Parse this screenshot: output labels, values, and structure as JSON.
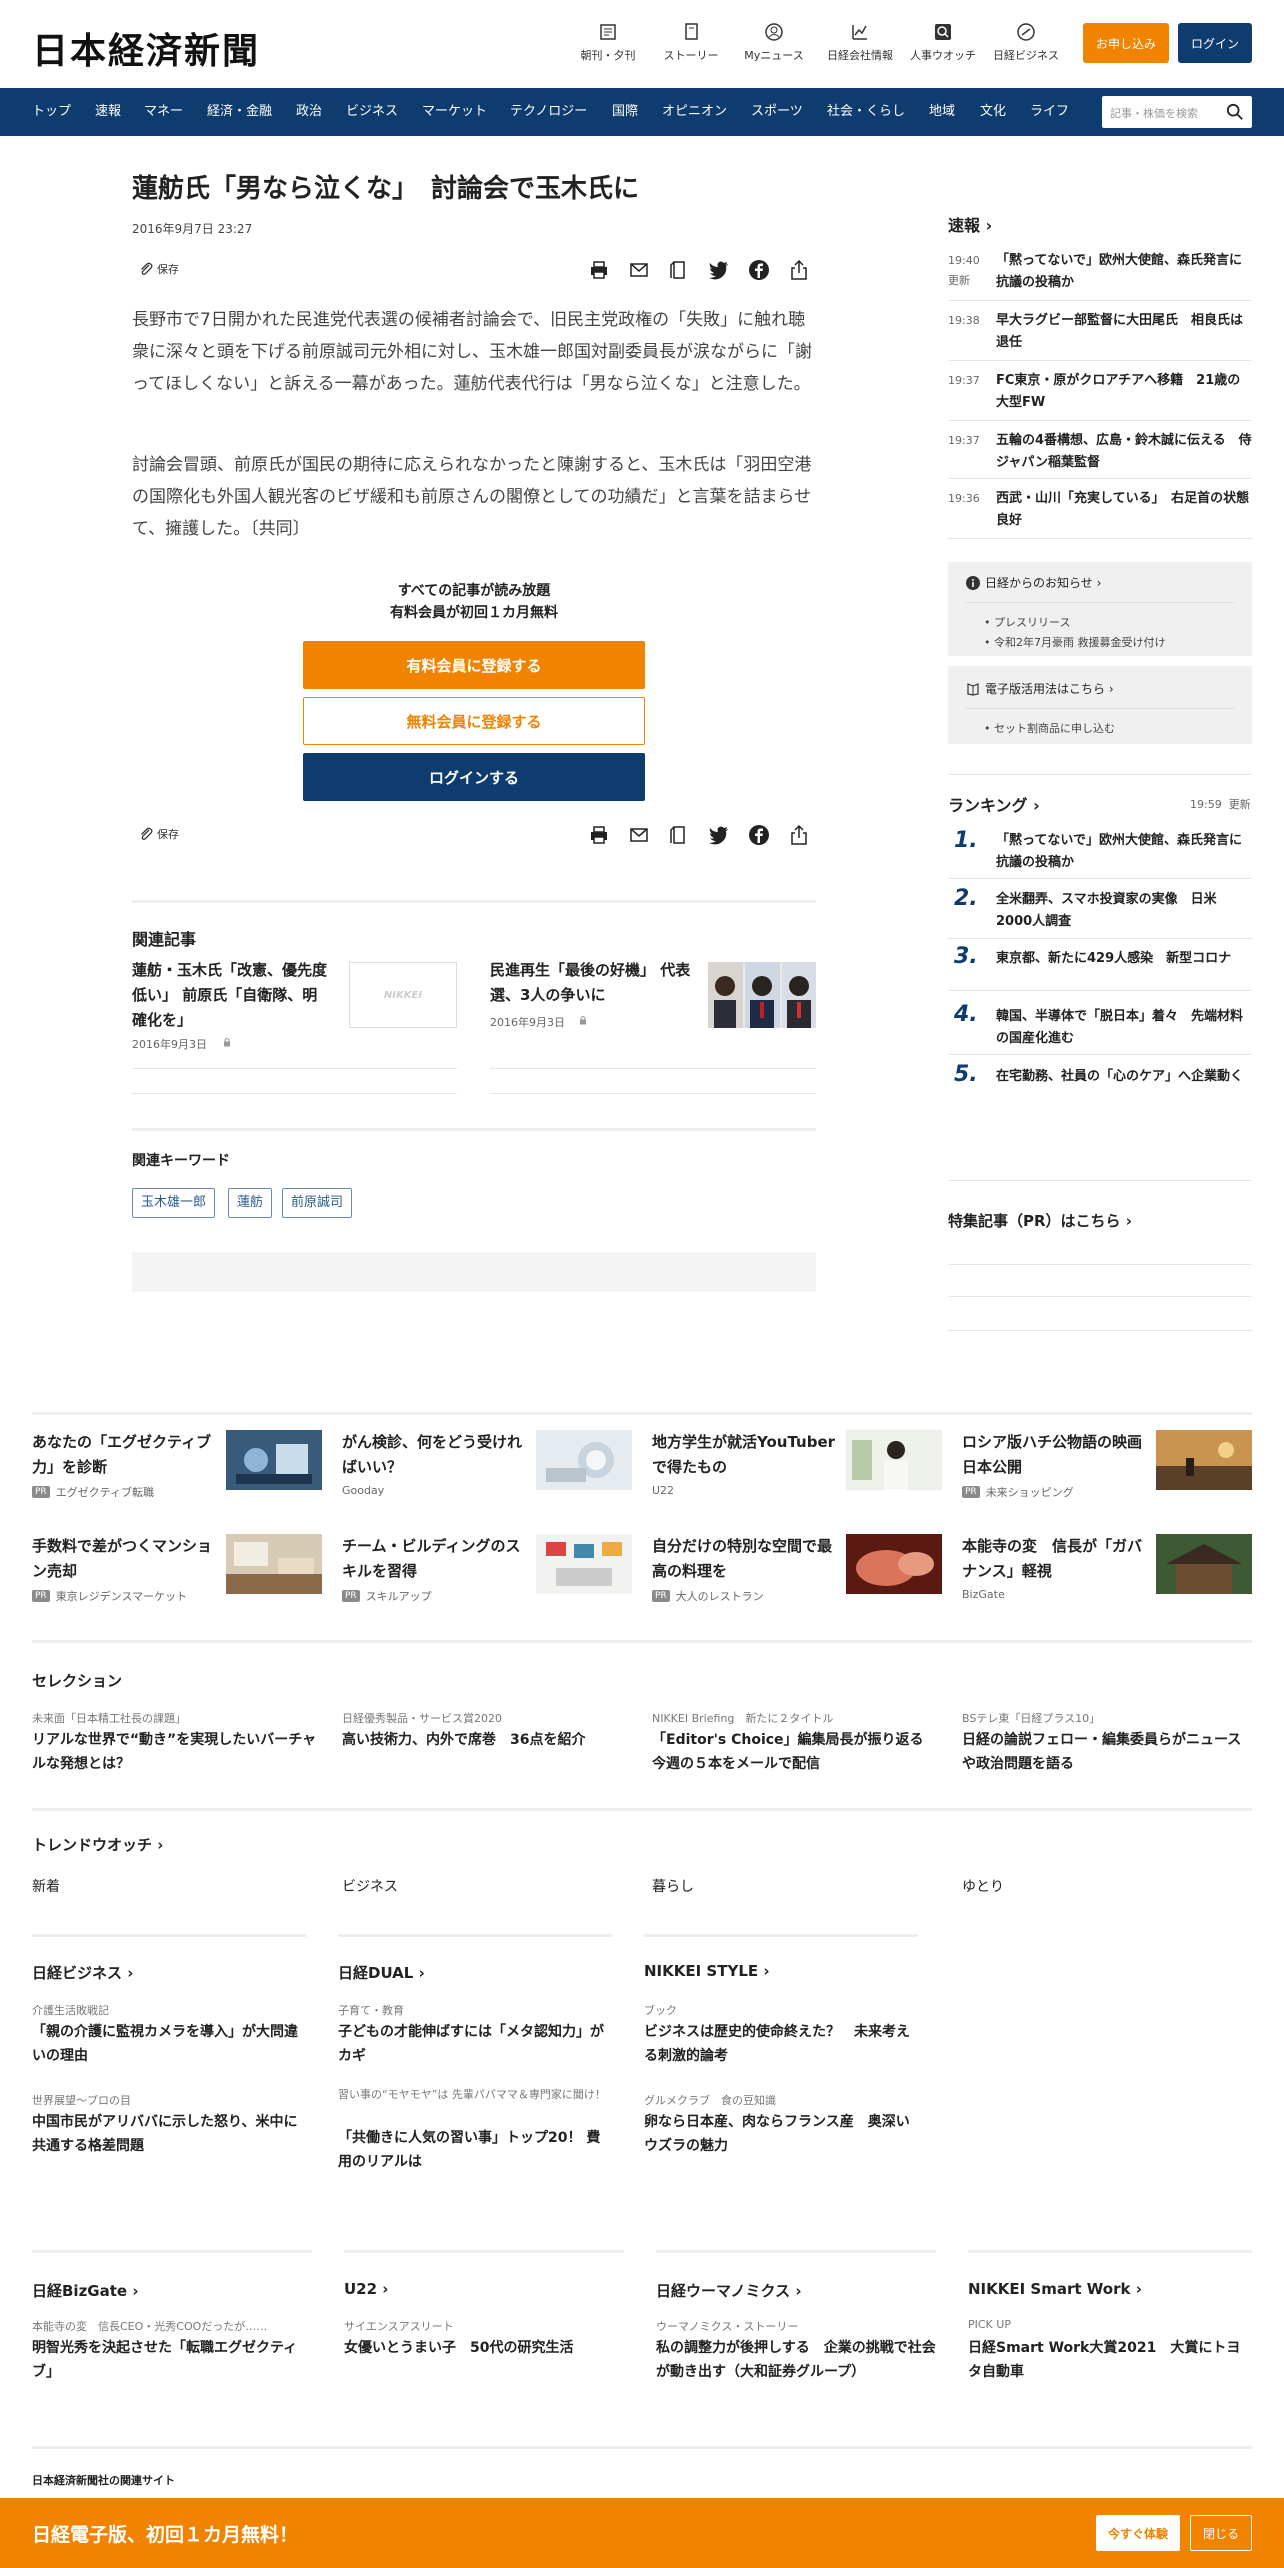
{
  "header": {
    "logo": "日本経済新聞",
    "nav": [
      {
        "label": "朝刊・夕刊",
        "icon": "newspaper-icon"
      },
      {
        "label": "ストーリー",
        "icon": "story-icon"
      },
      {
        "label": "Myニュース",
        "icon": "user-icon"
      },
      {
        "label": "日経会社情報",
        "icon": "chart-icon"
      },
      {
        "label": "人事ウオッチ",
        "icon": "search-person-icon"
      },
      {
        "label": "日経ビジネス",
        "icon": "business-icon"
      }
    ],
    "apply": "お申し込み",
    "login": "ログイン"
  },
  "navbar": {
    "items": [
      "トップ",
      "速報",
      "マネー",
      "経済・金融",
      "政治",
      "ビジネス",
      "マーケット",
      "テクノロジー",
      "国際",
      "オピニオン",
      "スポーツ",
      "社会・くらし",
      "地域",
      "文化",
      "ライフ"
    ],
    "search_placeholder": "記事・株価を検索"
  },
  "article": {
    "title": "蓮舫氏「男なら泣くな」　討論会で玉木氏に",
    "date": "2016年9月7日 23:27",
    "save": "保存",
    "paragraphs": [
      "長野市で7日開かれた民進党代表選の候補者討論会で、旧民主党政権の「失敗」に触れ聴衆に深々と頭を下げる前原誠司元外相に対し、玉木雄一郎国対副委員長が涙ながらに「謝ってほしくない」と訴える一幕があった。蓮舫代表代行は「男なら泣くな」と注意した。",
      "討論会冒頭、前原氏が国民の期待に応えられなかったと陳謝すると、玉木氏は「羽田空港の国際化も外国人観光客のビザ緩和も前原さんの閣僚としての功績だ」と言葉を詰まらせて、擁護した。〔共同〕"
    ],
    "promo_line1": "すべての記事が読み放題",
    "promo_line2": "有料会員が初回１カ月無料",
    "btn_paid": "有料会員に登録する",
    "btn_free": "無料会員に登録する",
    "btn_login": "ログインする"
  },
  "related": {
    "heading": "関連記事",
    "items": [
      {
        "title": "蓮舫・玉木氏「改憲、優先度低い」 前原氏「自衛隊、明確化を」",
        "date": "2016年9月3日"
      },
      {
        "title": "民進再生「最後の好機」 代表選、3人の争いに",
        "date": "2016年9月3日"
      }
    ],
    "placeholder_logo": "NIKKEI"
  },
  "keywords": {
    "heading": "関連キーワード",
    "items": [
      "玉木雄一郎",
      "蓮舫",
      "前原誠司"
    ]
  },
  "sidebar": {
    "sokuho": "速報",
    "news": [
      {
        "time": "19:40",
        "sub": "更新",
        "text": "「黙ってないで」欧州大使館、森氏発言に抗議の投稿か"
      },
      {
        "time": "19:38",
        "sub": "",
        "text": "早大ラグビー部監督に大田尾氏　相良氏は退任"
      },
      {
        "time": "19:37",
        "sub": "",
        "text": "FC東京・原がクロアチアへ移籍　21歳の大型FW"
      },
      {
        "time": "19:37",
        "sub": "",
        "text": "五輪の4番構想、広島・鈴木誠に伝える　侍ジャパン稲葉監督"
      },
      {
        "time": "19:36",
        "sub": "",
        "text": "西武・山川「充実している」　右足首の状態良好"
      }
    ],
    "notice_heading": "日経からのお知らせ",
    "notice_items": [
      "プレスリリース",
      "令和2年7月豪雨 救援募金受け付け"
    ],
    "ebook_heading": "電子版活用法はこちら",
    "ebook_items": [
      "セット割商品に申し込む"
    ],
    "ranking_heading": "ランキング",
    "ranking_time": "19:59",
    "ranking_update": "更新",
    "ranking": [
      {
        "no": "1.",
        "text": "「黙ってないで」欧州大使館、森氏発言に抗議の投稿か"
      },
      {
        "no": "2.",
        "text": "全米翻弄、スマホ投資家の実像　日米2000人調査"
      },
      {
        "no": "3.",
        "text": "東京都、新たに429人感染　新型コロナ"
      },
      {
        "no": "4.",
        "text": "韓国、半導体で「脱日本」着々　先端材料の国産化進む"
      },
      {
        "no": "5.",
        "text": "在宅勤務、社員の「心のケア」へ企業動く"
      }
    ],
    "special_heading": "特集記事（PR）はこちら"
  },
  "ads": [
    {
      "title": "あなたの「エグゼクティブ力」を診断",
      "src": "エグゼクティブ転職",
      "pr": true
    },
    {
      "title": "がん検診、何をどう受ければいい？",
      "src": "Gooday",
      "pr": false
    },
    {
      "title": "地方学生が就活YouTuberで得たもの",
      "src": "U22",
      "pr": false
    },
    {
      "title": "ロシア版ハチ公物語の映画日本公開",
      "src": "未来ショッピング",
      "pr": true
    },
    {
      "title": "手数料で差がつくマンション売却",
      "src": "東京レジデンスマーケット",
      "pr": true
    },
    {
      "title": "チーム・ビルディングのスキルを習得",
      "src": "スキルアップ",
      "pr": true
    },
    {
      "title": "自分だけの特別な空間で最高の料理を",
      "src": "大人のレストラン",
      "pr": true
    },
    {
      "title": "本能寺の変　信長が「ガバナンス」軽視",
      "src": "BizGate",
      "pr": false
    }
  ],
  "pr_label": "PR",
  "selection": {
    "heading": "セレクション",
    "items": [
      {
        "small": "未来面「日本精工社長の課題」",
        "title": "リアルな世界で“動き”を実現したいバーチャルな発想とは？"
      },
      {
        "small": "日経優秀製品・サービス賞2020",
        "title": "高い技術力、内外で席巻　36点を紹介"
      },
      {
        "small": "NIKKEI Briefing　新たに２タイトル",
        "title": "「Editor's Choice」編集局長が振り返る今週の５本をメールで配信"
      },
      {
        "small": "BSテレ東「日経プラス10」",
        "title": "日経の論説フェロー・編集委員らがニュースや政治問題を語る"
      }
    ]
  },
  "trend": {
    "heading": "トレンドウオッチ",
    "tabs": [
      "新着",
      "ビジネス",
      "暮らし",
      "ゆとり"
    ]
  },
  "columns": [
    {
      "heading": "日経ビジネス",
      "items": [
        {
          "small": "介護生活敗戦記",
          "title": "「親の介護に監視カメラを導入」が大問違いの理由"
        },
        {
          "small": "世界展望～プロの目",
          "title": "中国市民がアリババに示した怒り、米中に共通する格差問題"
        }
      ]
    },
    {
      "heading": "日経DUAL",
      "items": [
        {
          "small": "子育て・教育",
          "title": "子どもの才能伸ばすには「メタ認知力」がカギ"
        },
        {
          "small": "習い事の“モヤモヤ”は 先輩パパママ＆専門家に聞け！",
          "title": "「共働きに人気の習い事」トップ20！ 費用のリアルは"
        }
      ]
    },
    {
      "heading": "NIKKEI STYLE",
      "items": [
        {
          "small": "ブック",
          "title": "ビジネスは歴史的使命終えた？　未来考える刺激的論考"
        },
        {
          "small": "グルメクラブ　食の豆知識",
          "title": "卵なら日本産、肉ならフランス産　奥深いウズラの魅力"
        }
      ]
    }
  ],
  "columns2": [
    {
      "heading": "日経BizGate",
      "small": "本能寺の変　信長CEO・光秀COOだったが……",
      "title": "明智光秀を決起させた「転職エグゼクティブ」"
    },
    {
      "heading": "U22",
      "small": "サイエンスアスリート",
      "title": "女優いとうまい子　50代の研究生活"
    },
    {
      "heading": "日経ウーマノミクス",
      "small": "ウーマノミクス・ストーリー",
      "title": "私の調整力が後押しする　企業の挑戦で社会が動き出す（大和証券グループ）"
    },
    {
      "heading": "NIKKEI Smart Work",
      "small": "PICK UP",
      "title": "日経Smart Work大賞2021　大賞にトヨタ自動車"
    }
  ],
  "related_sites": "日本経済新聞社の関連サイト",
  "banner": {
    "text": "日経電子版、初回１カ月無料！",
    "try": "今すぐ体験",
    "close": "閉じる"
  },
  "colors": {
    "navy": "#0e3c6e",
    "orange": "#f08300"
  }
}
